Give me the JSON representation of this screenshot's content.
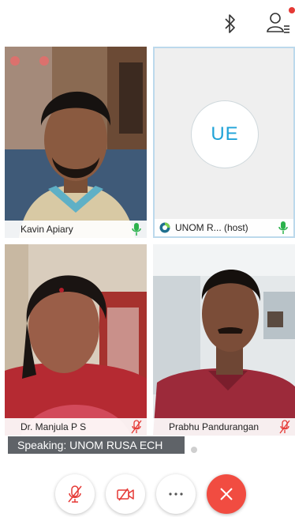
{
  "top_bar": {
    "icons": [
      "bluetooth-icon",
      "participants-icon"
    ],
    "notification_color": "#e53935"
  },
  "participants": [
    {
      "name": "Kavin Apiary",
      "mic": "on",
      "video": "on"
    },
    {
      "initials": "UE",
      "name": "UNOM R...  (host)",
      "mic": "on",
      "video": "off"
    },
    {
      "name": "Dr. Manjula P S",
      "mic": "muted",
      "video": "on"
    },
    {
      "name": "Prabhu Pandurangan",
      "mic": "muted",
      "video": "on"
    }
  ],
  "speaking_banner": "Speaking: UNOM RUSA ECH",
  "controls": [
    "mute-microphone",
    "stop-video",
    "more",
    "end-call"
  ],
  "colors": {
    "mic_on": "#2bb24c",
    "mic_muted": "#e53935",
    "accent": "#20a3d8",
    "end_call": "#f14c41"
  }
}
